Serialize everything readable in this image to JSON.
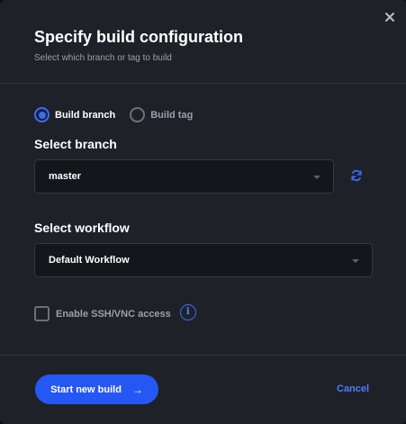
{
  "dialog": {
    "title": "Specify build configuration",
    "subtitle": "Select which branch or tag to build",
    "close_icon": "close-icon"
  },
  "build_type": {
    "options": [
      {
        "label": "Build branch",
        "selected": true
      },
      {
        "label": "Build tag",
        "selected": false
      }
    ]
  },
  "branch": {
    "label": "Select branch",
    "value": "master",
    "refresh_icon": "refresh-icon"
  },
  "workflow": {
    "label": "Select workflow",
    "value": "Default Workflow"
  },
  "ssh": {
    "label": "Enable SSH/VNC access",
    "checked": false,
    "info_glyph": "i"
  },
  "footer": {
    "start_label": "Start new build",
    "start_arrow": "→",
    "cancel_label": "Cancel"
  },
  "colors": {
    "accent": "#2557f5",
    "link": "#4f7cff",
    "background": "#1e2128"
  }
}
